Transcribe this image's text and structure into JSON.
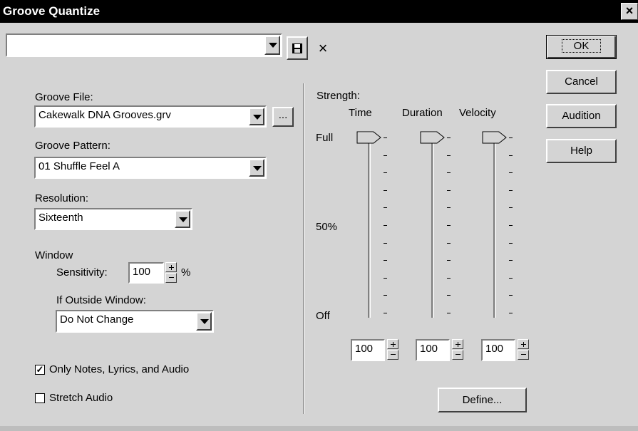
{
  "window": {
    "title": "Groove Quantize",
    "close_label": "×"
  },
  "preset": {
    "value": "",
    "save_icon": "floppy-disk-icon",
    "delete_label": "×"
  },
  "buttons": {
    "ok": "OK",
    "cancel": "Cancel",
    "audition": "Audition",
    "help": "Help",
    "define": "Define...",
    "browse": "..."
  },
  "groove_file": {
    "label": "Groove File:",
    "value": "Cakewalk DNA Grooves.grv"
  },
  "groove_pattern": {
    "label": "Groove Pattern:",
    "value": "01 Shuffle Feel A"
  },
  "resolution": {
    "label": "Resolution:",
    "value": "Sixteenth"
  },
  "window_group": {
    "label": "Window",
    "sensitivity_label": "Sensitivity:",
    "sensitivity_value": "100",
    "sensitivity_unit": "%",
    "outside_label": "If Outside Window:",
    "outside_value": "Do Not Change"
  },
  "options": {
    "only_notes": {
      "label": "Only Notes, Lyrics, and Audio",
      "checked": true,
      "mark": "✓"
    },
    "stretch_audio": {
      "label": "Stretch Audio",
      "checked": false
    }
  },
  "strength": {
    "label": "Strength:",
    "scale": {
      "full": "Full",
      "half": "50%",
      "off": "Off"
    },
    "time": {
      "label": "Time",
      "value": "100",
      "level": 1.0
    },
    "duration": {
      "label": "Duration",
      "value": "100",
      "level": 1.0
    },
    "velocity": {
      "label": "Velocity",
      "value": "100",
      "level": 1.0
    }
  }
}
